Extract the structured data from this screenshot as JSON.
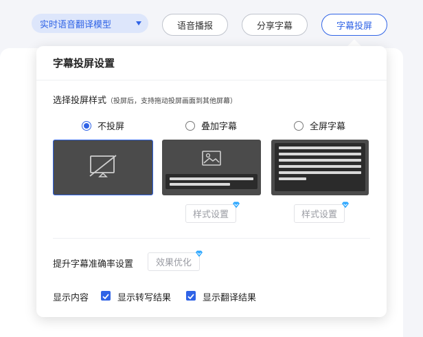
{
  "toolbar": {
    "model_select": "实时语音翻译模型",
    "voice_broadcast": "语音播报",
    "share_subtitles": "分享字幕",
    "subtitle_projection": "字幕投屏"
  },
  "popup": {
    "title": "字幕投屏设置",
    "style_section": {
      "heading": "选择投屏样式",
      "note": "（投屏后，支持拖动投屏画面到其他屏幕）",
      "options": [
        {
          "label": "不投屏",
          "selected": true
        },
        {
          "label": "叠加字幕",
          "selected": false
        },
        {
          "label": "全屏字幕",
          "selected": false
        }
      ],
      "style_button": "样式设置"
    },
    "accuracy": {
      "label": "提升字幕准确率设置",
      "button": "效果优化"
    },
    "display": {
      "label": "显示内容",
      "transcription": "显示转写结果",
      "translation": "显示翻译结果",
      "transcription_checked": true,
      "translation_checked": true
    }
  },
  "colors": {
    "accent": "#2f63e6",
    "vip": "#2ea8ff",
    "preview_bg": "#4b4b4b"
  }
}
